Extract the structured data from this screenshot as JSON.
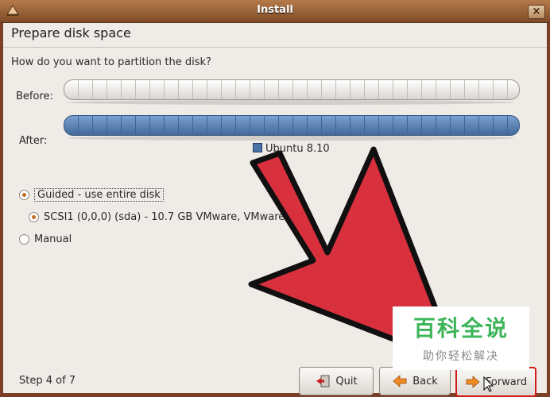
{
  "window": {
    "title": "Install"
  },
  "page": {
    "heading": "Prepare disk space",
    "question": "How do you want to partition the disk?",
    "before_label": "Before:",
    "after_label": "After:",
    "legend_label": "Ubuntu 8.10"
  },
  "options": {
    "guided": "Guided - use entire disk",
    "disk": "SCSI1 (0,0,0) (sda) - 10.7 GB VMware, VMware",
    "manual": "Manual"
  },
  "footer": {
    "step": "Step 4 of 7",
    "quit": "Quit",
    "back": "Back",
    "forward": "Forward"
  },
  "watermark": {
    "title": "百科全说",
    "subtitle": "助你轻松解决"
  },
  "colors": {
    "accent_arrow": "#d8303d",
    "partition_blue": "#4a72a5",
    "titlebar": "#8e5a33"
  }
}
